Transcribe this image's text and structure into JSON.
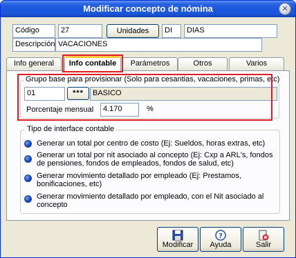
{
  "window": {
    "title": "Modificar concepto de nómina",
    "close_glyph": "✕"
  },
  "header": {
    "codigo_label": "Código",
    "codigo_value": "27",
    "unidades_button": "Unidades",
    "unidad_code": "DI",
    "unidad_name": "DIAS",
    "descripcion_label": "Descripción",
    "descripcion_value": "VACACIONES"
  },
  "tabs": [
    {
      "label": "Info general"
    },
    {
      "label": "Info contable"
    },
    {
      "label": "Parámetros"
    },
    {
      "label": "Otros"
    },
    {
      "label": "Varios"
    }
  ],
  "grupo": {
    "title": "Grupo base para provisionar (Solo para cesantias, vacaciones, primas, etc)",
    "code": "01",
    "lookup_button": "***",
    "name": "BASICO",
    "porcentaje_label": "Porcentaje mensual",
    "porcentaje_value": "4.170",
    "percent_sign": "%"
  },
  "interface": {
    "title": "Tipo de interface contable",
    "options": [
      {
        "text": "Generar un total por centro de costo (Ej: Sueldos, horas extras, etc)"
      },
      {
        "text": "Generar un total por nit asociado al concepto (Ej: Cxp a ARL's, fondos de pensiones, fondos de empleados, fondos de salud, etc)"
      },
      {
        "text": "Generar movimiento detallado por empleado (Ej: Prestamos, bonificaciones, etc)"
      },
      {
        "text": "Generar movimiento detallado por empleado, con el Nit asociado al concepto"
      }
    ]
  },
  "footer": {
    "modificar": {
      "label": "Modificar",
      "icon": "save-icon"
    },
    "ayuda": {
      "label": "Ayuda",
      "icon": "help-icon"
    },
    "salir": {
      "label": "Salir",
      "icon": "exit-icon"
    }
  },
  "colors": {
    "titlebar": "#1d56d8",
    "highlight": "#e01b24",
    "radio": "#1a3ec0"
  }
}
